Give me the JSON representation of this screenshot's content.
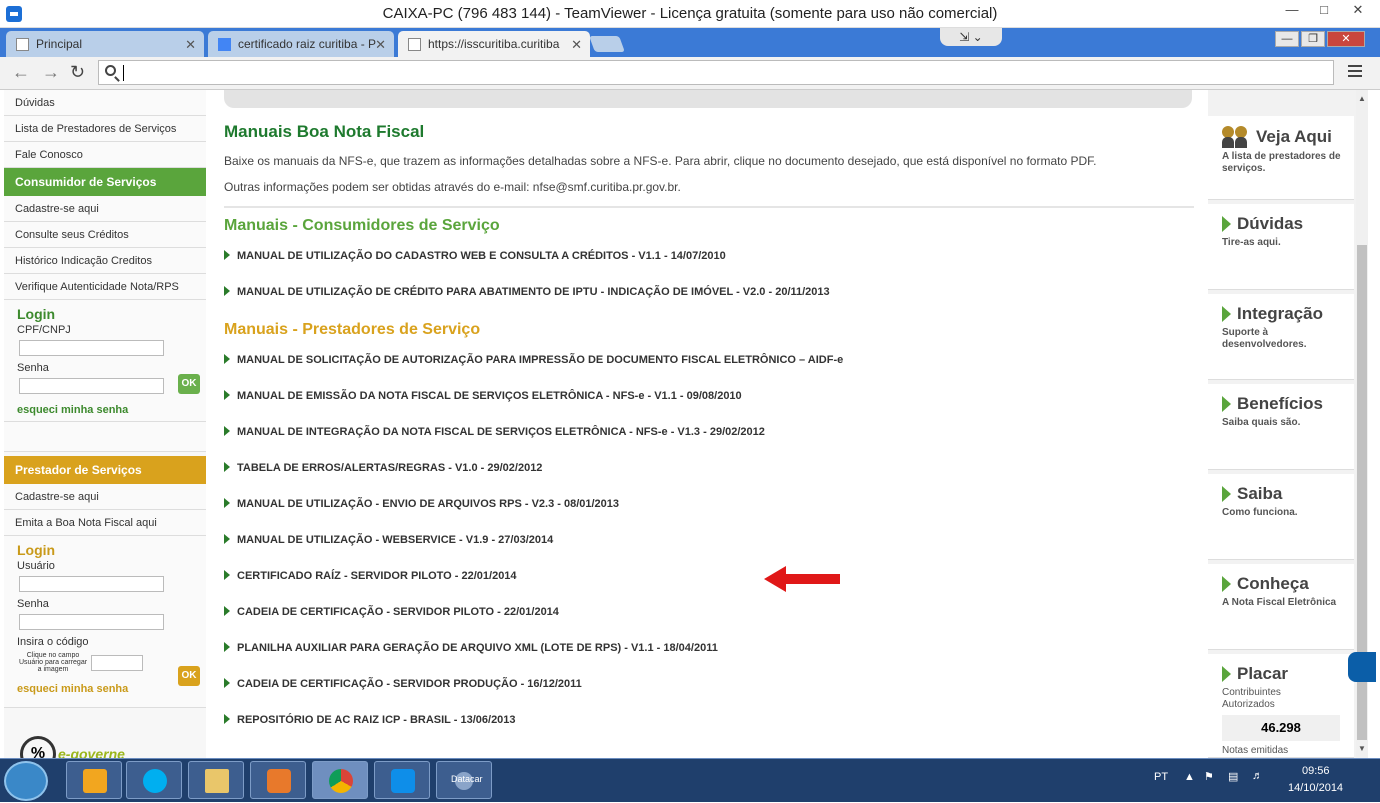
{
  "window": {
    "title": "CAIXA-PC (796 483 144) - TeamViewer - Licença gratuita (somente para uso não comercial)"
  },
  "tabs": [
    {
      "label": "Principal"
    },
    {
      "label": "certificado raiz curitiba - P"
    },
    {
      "label": "https://isscuritiba.curitiba"
    }
  ],
  "left": {
    "links_top": [
      "Dúvidas",
      "Lista de Prestadores de Serviços",
      "Fale Conosco"
    ],
    "consumidor": {
      "header": "Consumidor de Serviços",
      "links": [
        "Cadastre-se aqui",
        "Consulte seus Créditos",
        "Histórico Indicação Creditos",
        "Verifique Autenticidade Nota/RPS"
      ]
    },
    "login1": {
      "title": "Login",
      "user_label": "CPF/CNPJ",
      "pass_label": "Senha",
      "ok": "OK",
      "forgot": "esqueci minha senha"
    },
    "prestador": {
      "header": "Prestador de Serviços",
      "links": [
        "Cadastre-se aqui",
        "Emita a Boa Nota Fiscal aqui"
      ]
    },
    "login2": {
      "title": "Login",
      "user_label": "Usuário",
      "pass_label": "Senha",
      "code_label": "Insira o código",
      "captcha_hint": "Clique no campo Usuário para carregar a imagem",
      "ok": "OK",
      "forgot": "esqueci minha senha"
    },
    "logo_text": "e-governe"
  },
  "main": {
    "title": "Manuais Boa Nota Fiscal",
    "intro1": "Baixe os manuais da NFS-e, que trazem as informações detalhadas sobre a NFS-e. Para abrir, clique no documento desejado, que está disponível no formato PDF.",
    "intro2": "Outras informações podem ser obtidas através do e-mail: nfse@smf.curitiba.pr.gov.br.",
    "section_consumidores": "Manuais - Consumidores de Serviço",
    "consumidores": [
      "MANUAL DE UTILIZAÇÃO DO CADASTRO WEB E CONSULTA A CRÉDITOS - V1.1 - 14/07/2010",
      "MANUAL DE UTILIZAÇÃO DE CRÉDITO PARA ABATIMENTO DE IPTU - INDICAÇÃO DE IMÓVEL - V2.0 - 20/11/2013"
    ],
    "section_prestadores": "Manuais - Prestadores de Serviço",
    "prestadores": [
      "MANUAL DE SOLICITAÇÃO DE AUTORIZAÇÃO PARA IMPRESSÃO DE DOCUMENTO FISCAL ELETRÔNICO – AIDF-e",
      "MANUAL DE EMISSÃO DA NOTA FISCAL DE SERVIÇOS ELETRÔNICA - NFS-e - V1.1 - 09/08/2010",
      "MANUAL DE INTEGRAÇÃO DA NOTA FISCAL DE SERVIÇOS ELETRÔNICA - NFS-e - V1.3 - 29/02/2012",
      "TABELA DE ERROS/ALERTAS/REGRAS - V1.0 - 29/02/2012",
      "MANUAL DE UTILIZAÇÃO - ENVIO DE ARQUIVOS RPS - V2.3 - 08/01/2013",
      "MANUAL DE UTILIZAÇÃO - WEBSERVICE - V1.9 - 27/03/2014",
      "CERTIFICADO RAÍZ - SERVIDOR PILOTO - 22/01/2014",
      "CADEIA DE CERTIFICAÇÃO - SERVIDOR PILOTO - 22/01/2014",
      "PLANILHA AUXILIAR PARA GERAÇÃO DE ARQUIVO XML (LOTE DE RPS) - V1.1 - 18/04/2011",
      "CADEIA DE CERTIFICAÇÃO - SERVIDOR PRODUÇÃO - 16/12/2011",
      "REPOSITÓRIO DE AC RAIZ ICP - BRASIL - 13/06/2013"
    ]
  },
  "right": [
    {
      "title": "Veja Aqui",
      "sub": "A lista de prestadores de serviços."
    },
    {
      "title": "Dúvidas",
      "sub": "Tire-as aqui."
    },
    {
      "title": "Integração",
      "sub": "Suporte à desenvolvedores."
    },
    {
      "title": "Benefícios",
      "sub": "Saiba quais são."
    },
    {
      "title": "Saiba",
      "sub": "Como funciona."
    },
    {
      "title": "Conheça",
      "sub": "A Nota Fiscal Eletrônica"
    },
    {
      "title": "Placar",
      "sub": "Contribuintes Autorizados",
      "value": "46.298",
      "more": "Notas emitidas"
    }
  ],
  "taskbar": {
    "datacar_label": "Datacar",
    "lang": "PT",
    "time": "09:56",
    "date": "14/10/2014"
  },
  "colors": {
    "green_header": "#5aa53c",
    "orange_header": "#d9a21d",
    "title_green": "#1e7a2e",
    "section_green": "#5aa53c",
    "section_orange": "#d9a21d",
    "red_arrow": "#e01818"
  }
}
